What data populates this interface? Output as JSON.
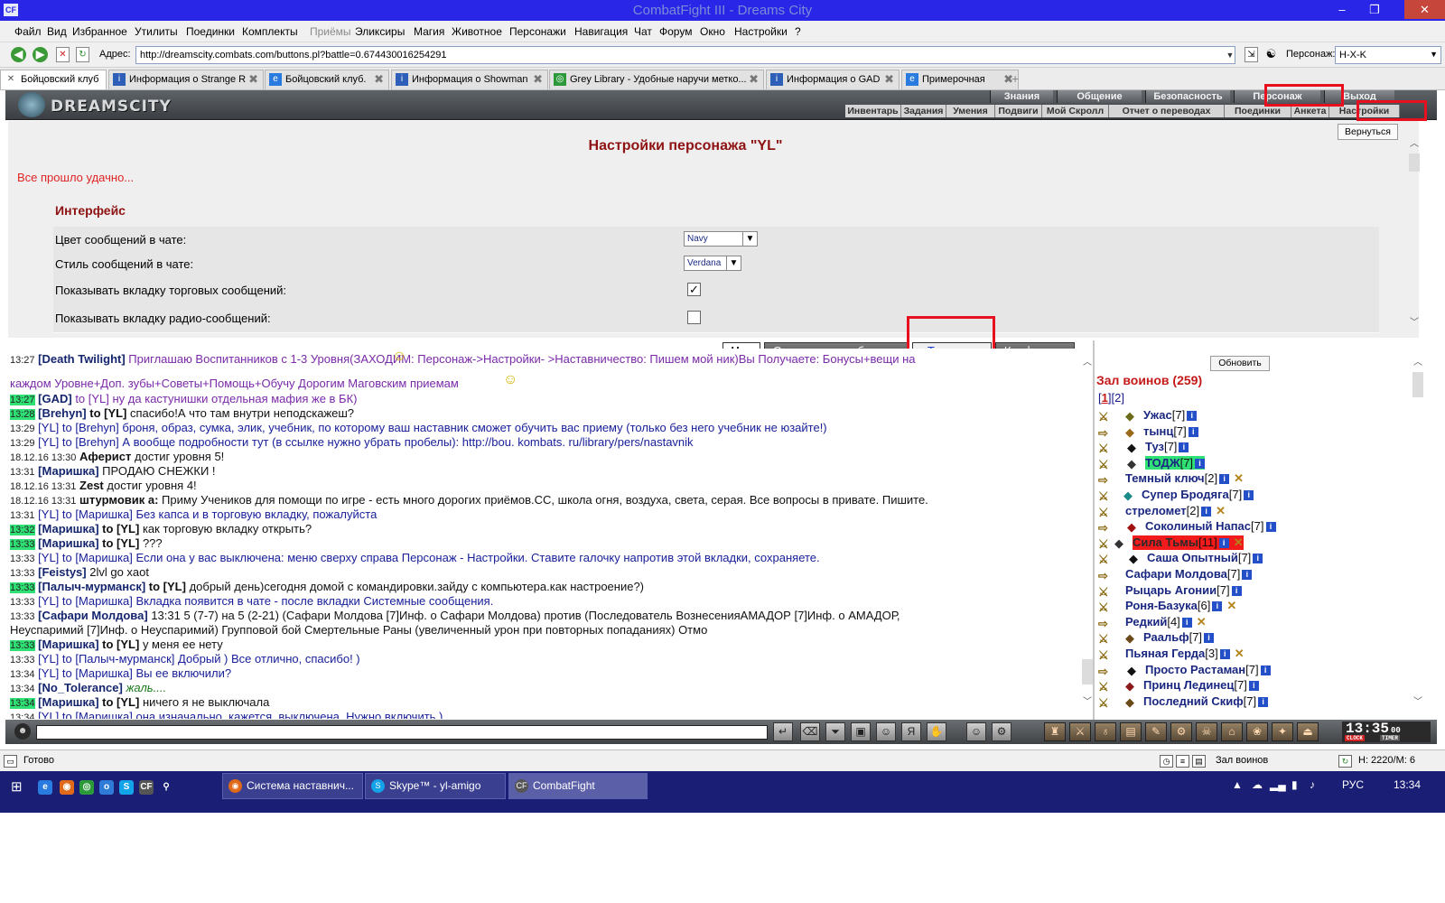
{
  "window": {
    "title": "CombatFight III - Dreams City",
    "app_icon": "CF",
    "buttons": [
      "–",
      "❐",
      "✕"
    ]
  },
  "menu": [
    {
      "label": "Файл",
      "dim": false
    },
    {
      "label": "Вид",
      "dim": false
    },
    {
      "label": "Избранное",
      "dim": false
    },
    {
      "label": "Утилиты",
      "dim": false
    },
    {
      "label": "Поединки",
      "dim": false
    },
    {
      "label": "Комплекты",
      "dim": false
    },
    {
      "label": "Приёмы",
      "dim": true
    },
    {
      "label": "Эликсиры",
      "dim": false
    },
    {
      "label": "Магия",
      "dim": false
    },
    {
      "label": "Животное",
      "dim": false
    },
    {
      "label": "Персонажи",
      "dim": false
    },
    {
      "label": "Навигация",
      "dim": false
    },
    {
      "label": "Чат",
      "dim": false
    },
    {
      "label": "Форум",
      "dim": false
    },
    {
      "label": "Окно",
      "dim": false
    },
    {
      "label": "Настройки",
      "dim": false
    },
    {
      "label": "?",
      "dim": false
    }
  ],
  "addressbar": {
    "label": "Адрес:",
    "url": "http://dreamscity.combats.com/buttons.pl?battle=0.674430016254291",
    "character_label": "Персонаж:",
    "character_value": "H-X-K"
  },
  "tabs": [
    {
      "label": "Бойцовский клуб",
      "active": true
    },
    {
      "label": "Информация о Strange R",
      "active": false
    },
    {
      "label": "Бойцовский клуб.",
      "active": false
    },
    {
      "label": "Информация о Showman",
      "active": false
    },
    {
      "label": "Grey Library - Удобные наручи метко...",
      "active": false
    },
    {
      "label": "Информация о GAD",
      "active": false
    },
    {
      "label": "Примерочная",
      "active": false
    }
  ],
  "game_header": {
    "logo": "DREAMSCITY",
    "top_nav": [
      "Знания",
      "Общение",
      "Безопасность",
      "Персонаж",
      "Выход"
    ],
    "sub_nav": [
      "Инвентарь",
      "Задания",
      "Умения",
      "Подвиги",
      "Мой Скролл",
      "Отчет о переводах",
      "Поединки",
      "Анкета",
      "Настройки"
    ]
  },
  "settings": {
    "back_button": "Вернуться",
    "title": "Настройки персонажа \"YL\"",
    "success": "Все прошло удачно...",
    "section": "Интерфейс",
    "rows": [
      {
        "label": "Цвет сообщений в чате:",
        "type": "select",
        "value": "Navy"
      },
      {
        "label": "Стиль сообщений в чате:",
        "type": "select",
        "value": "Verdana"
      },
      {
        "label": "Показывать вкладку торговых сообщений:",
        "type": "checkbox",
        "checked": true
      },
      {
        "label": "Показывать вкладку радио-сообщений:",
        "type": "checkbox",
        "checked": false
      }
    ]
  },
  "chat_tabs": [
    "Чат",
    "Системные сообщения",
    "Торговля",
    "Конфликты"
  ],
  "chat": [
    {
      "time": "13:27",
      "hl": false,
      "parts": [
        [
          "nk",
          "[Death Twilight]"
        ],
        [
          "pr",
          " Приглашаю Воспитанников с 1-3 Уровня"
        ],
        [
          "pr",
          "(ЗАХОДИМ: Персонаж->Настройки- >Наставничество: Пишем мой ник)Вы Получаете: Бонусы+вещи на"
        ]
      ]
    },
    {
      "time": "",
      "hl": false,
      "parts": [
        [
          "pr",
          "каждом Уровне+Доп. зубы+Советы+Помощь+Обучу Дорогим Маговским приемам"
        ]
      ]
    },
    {
      "time": "13:27",
      "hl": true,
      "parts": [
        [
          "nk",
          "[GAD]"
        ],
        [
          "pr",
          " to [YL] ну да кастунишки отдельная мафия же в БК)"
        ]
      ]
    },
    {
      "time": "13:28",
      "hl": true,
      "parts": [
        [
          "nk",
          "[Brehyn]"
        ],
        [
          "tx",
          " "
        ],
        [
          "tb",
          "to [YL]"
        ],
        [
          "tx",
          " спасибо!А что там внутри неподскажеш?"
        ]
      ]
    },
    {
      "time": "13:29",
      "hl": false,
      "parts": [
        [
          "bl",
          "[YL] to [Brehyn] броня, образ, сумка, элик, учебник, по которому ваш наставник сможет обучить вас приему (только без него учебник не юзайте!)"
        ]
      ]
    },
    {
      "time": "13:29",
      "hl": false,
      "parts": [
        [
          "bl",
          "[YL] to [Brehyn] А вообще подробности тут (в ссылке нужно убрать пробелы): http://bou. kombats. ru/library/pers/nastavnik"
        ]
      ]
    },
    {
      "time": "18.12.16 13:30",
      "hl": false,
      "parts": [
        [
          "tb",
          "Аферист"
        ],
        [
          "tx",
          " достиг уровня 5!"
        ]
      ]
    },
    {
      "time": "13:31",
      "hl": false,
      "parts": [
        [
          "nk",
          "[Маришка]"
        ],
        [
          "tx",
          " ПРОДАЮ СНЕЖКИ !"
        ]
      ]
    },
    {
      "time": "18.12.16 13:31",
      "hl": false,
      "parts": [
        [
          "tb",
          "Zest"
        ],
        [
          "tx",
          " достиг уровня 4!"
        ]
      ]
    },
    {
      "time": "18.12.16 13:31",
      "hl": false,
      "parts": [
        [
          "tb",
          "штурмовик а:"
        ],
        [
          "tx",
          " Приму Учеников для помощи по игре - есть много дорогих приёмов.СС, школа огня, воздуха, света, серая. Все вопросы в привате. Пишите."
        ]
      ]
    },
    {
      "time": "13:31",
      "hl": false,
      "parts": [
        [
          "bl",
          "[YL] to [Маришка] Без капса и в торговую вкладку, пожалуйста"
        ]
      ]
    },
    {
      "time": "13:32",
      "hl": true,
      "parts": [
        [
          "nk",
          "[Маришка]"
        ],
        [
          "tx",
          " "
        ],
        [
          "tb",
          "to [YL]"
        ],
        [
          "tx",
          " как торговую вкладку открыть?"
        ]
      ]
    },
    {
      "time": "13:33",
      "hl": true,
      "parts": [
        [
          "nk",
          "[Маришка]"
        ],
        [
          "tx",
          " "
        ],
        [
          "tb",
          "to [YL]"
        ],
        [
          "tx",
          " ???"
        ]
      ]
    },
    {
      "time": "13:33",
      "hl": false,
      "parts": [
        [
          "bl",
          "[YL] to [Маришка] Если она у вас выключена: меню сверху справа Персонаж - Настройки. Ставите галочку напротив этой вкладки, сохраняете."
        ]
      ]
    },
    {
      "time": "13:33",
      "hl": false,
      "parts": [
        [
          "nk",
          "[Feistys]"
        ],
        [
          "tx",
          " 2lvl go xaot"
        ]
      ]
    },
    {
      "time": "13:33",
      "hl": true,
      "parts": [
        [
          "nk",
          "[Палыч-мурманск]"
        ],
        [
          "tx",
          " "
        ],
        [
          "tb",
          "to [YL]"
        ],
        [
          "tx",
          " добрый день)сегодня домой с командировки.зайду с компьютера.как настроение?)"
        ]
      ]
    },
    {
      "time": "13:33",
      "hl": false,
      "parts": [
        [
          "bl",
          "[YL] to [Маришка] Вкладка появится в чате - после вкладки Системные сообщения."
        ]
      ]
    },
    {
      "time": "13:33",
      "hl": false,
      "parts": [
        [
          "nk",
          "[Сафари Молдова]"
        ],
        [
          "tx",
          " 13:31 5 (7-7) на 5 (2-21) (Сафари Молдова [7]Инф. о Сафари Молдова) против (Последователь ВознесенияАМАДОР [7]Инф. о АМАДОР,"
        ]
      ]
    },
    {
      "time": "",
      "hl": false,
      "parts": [
        [
          "tx",
          "Неуспаримий [7]Инф. о Неуспаримий) Групповой бой Смертельные Раны (увеличенный урон при повторных попаданиях) Отмо"
        ]
      ]
    },
    {
      "time": "13:33",
      "hl": true,
      "parts": [
        [
          "nk",
          "[Маришка]"
        ],
        [
          "tx",
          " "
        ],
        [
          "tb",
          "to [YL]"
        ],
        [
          "tx",
          " у меня ее нету"
        ]
      ]
    },
    {
      "time": "13:33",
      "hl": false,
      "parts": [
        [
          "bl",
          "[YL] to [Палыч-мурманск] Добрый ) Все отлично, спасибо! )"
        ]
      ]
    },
    {
      "time": "13:34",
      "hl": false,
      "parts": [
        [
          "bl",
          "[YL] to [Маришка] Вы ее включили?"
        ]
      ]
    },
    {
      "time": "13:34",
      "hl": false,
      "parts": [
        [
          "nk",
          "[No_Tolerance]"
        ],
        [
          "gr",
          " жаль...."
        ]
      ]
    },
    {
      "time": "13:34",
      "hl": true,
      "parts": [
        [
          "nk",
          "[Маришка]"
        ],
        [
          "tx",
          " "
        ],
        [
          "tb",
          "to [YL]"
        ],
        [
          "tx",
          " ничего я не выключала"
        ]
      ]
    },
    {
      "time": "13:34",
      "hl": false,
      "parts": [
        [
          "bl",
          "[YL] to [Маришка] она изначально, кажется, выключена. Нужно включить )"
        ]
      ]
    }
  ],
  "hall": {
    "refresh": "Обновить",
    "title": "Зал воинов (259)",
    "page_current": "1",
    "page_other": "2",
    "players": [
      {
        "name": "Ужас",
        "level": "[7]",
        "style": "",
        "x": false
      },
      {
        "name": "тынц",
        "level": "[7]",
        "style": "",
        "x": false
      },
      {
        "name": "Туз",
        "level": "[7]",
        "style": "",
        "x": false
      },
      {
        "name": "ТОДЖ",
        "level": "[7]",
        "style": "g",
        "x": false
      },
      {
        "name": "Темный ключ",
        "level": "[2]",
        "style": "",
        "x": true
      },
      {
        "name": "Супер Бродяга",
        "level": "[7]",
        "style": "",
        "x": false
      },
      {
        "name": "стреломет",
        "level": "[2]",
        "style": "",
        "x": true
      },
      {
        "name": "Соколиный Напас",
        "level": "[7]",
        "style": "",
        "x": false
      },
      {
        "name": "Сила Тьмы",
        "level": "[11]",
        "style": "r",
        "x": true
      },
      {
        "name": "Саша Опытный",
        "level": "[7]",
        "style": "",
        "x": false
      },
      {
        "name": "Сафари Молдова",
        "level": "[7]",
        "style": "",
        "x": false
      },
      {
        "name": "Рыцарь Агонии",
        "level": "[7]",
        "style": "",
        "x": false
      },
      {
        "name": "Роня-Базука",
        "level": "[6]",
        "style": "",
        "x": true
      },
      {
        "name": "Редкий",
        "level": "[4]",
        "style": "",
        "x": true
      },
      {
        "name": "Раальф",
        "level": "[7]",
        "style": "",
        "x": false
      },
      {
        "name": "Пьяная Герда",
        "level": "[3]",
        "style": "",
        "x": true
      },
      {
        "name": "Просто Растаман",
        "level": "[7]",
        "style": "",
        "x": false
      },
      {
        "name": "Принц Лединец",
        "level": "[7]",
        "style": "",
        "x": false
      },
      {
        "name": "Последний Скиф",
        "level": "[7]",
        "style": "",
        "x": false
      }
    ]
  },
  "clock": {
    "time": "13:35",
    "sec": "00",
    "clock_label": "CLOCK",
    "timer_label": "TIMER"
  },
  "status": {
    "left": "Готово",
    "room": "Зал воинов",
    "hp": "H: 2220/M: 6"
  },
  "taskbar": {
    "tasks": [
      {
        "label": "Система наставнич...",
        "active": false
      },
      {
        "label": "Skype™ - yl-amigo",
        "active": false
      },
      {
        "label": "CombatFight",
        "active": true
      }
    ],
    "lang": "РУС",
    "time": "13:34"
  },
  "colors": {
    "titlebar": "#2a26e8",
    "highlight_box": "#e8101e",
    "title_red": "#8e1212",
    "nick_blue": "#14256e",
    "private_purple": "#7a29a8",
    "time_highlight": "#2fe075"
  }
}
